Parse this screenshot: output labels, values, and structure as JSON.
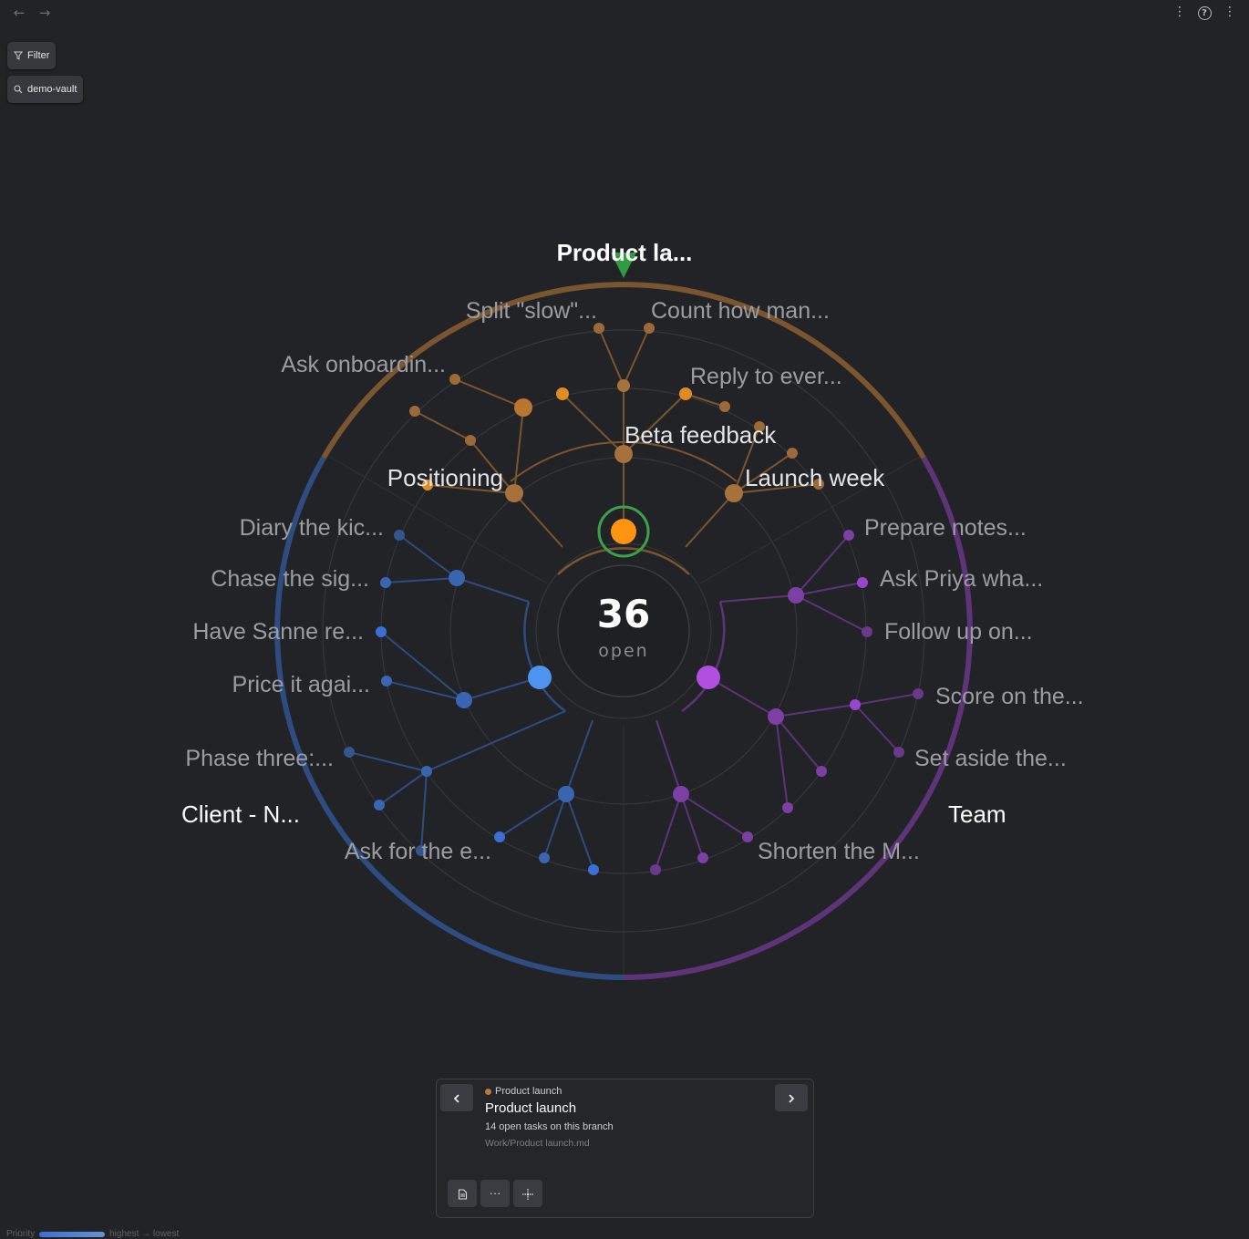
{
  "nav": {
    "back_icon": "arrow-left-icon",
    "forward_icon": "arrow-right-icon"
  },
  "topbar": {
    "more_icon": "more-vertical-icon",
    "help_icon": "help-circle-icon"
  },
  "chips": {
    "filter_label": "Filter",
    "vault_label": "demo-vault"
  },
  "center": {
    "count": "36",
    "caption": "open"
  },
  "labels": {
    "top": "Product la...",
    "t1": "Split \"slow\"...",
    "t2": "Count how man...",
    "t3": "Ask onboardin...",
    "t4": "Reply to ever...",
    "beta": "Beta feedback",
    "positioning": "Positioning",
    "launch": "Launch week",
    "l1": "Diary the kic...",
    "l2": "Chase the sig...",
    "l3": "Have Sanne re...",
    "l4": "Price it agai...",
    "l5": "Phase three:...",
    "client": "Client - N...",
    "l6": "Ask for the e...",
    "r1": "Prepare notes...",
    "r2": "Ask Priya wha...",
    "r3": "Follow up on...",
    "r4": "Score on the...",
    "r5": "Set aside the...",
    "team": "Team",
    "r6": "Shorten the M..."
  },
  "colors": {
    "product": "#b57a3c",
    "client": "#3b6fd6",
    "team": "#a54ed8",
    "focus": "#3aa24b",
    "ring": "#3a3c40"
  },
  "panel": {
    "crumb": "Product launch",
    "title": "Product launch",
    "count_text": "14 open tasks on this branch",
    "path": "Work/Product launch.md",
    "prev_icon": "chevron-left-icon",
    "next_icon": "chevron-right-icon",
    "actions": [
      "file-icon",
      "more-horizontal-icon",
      "focus-icon"
    ]
  },
  "legend": {
    "label": "Priority",
    "range": "highest → lowest"
  }
}
